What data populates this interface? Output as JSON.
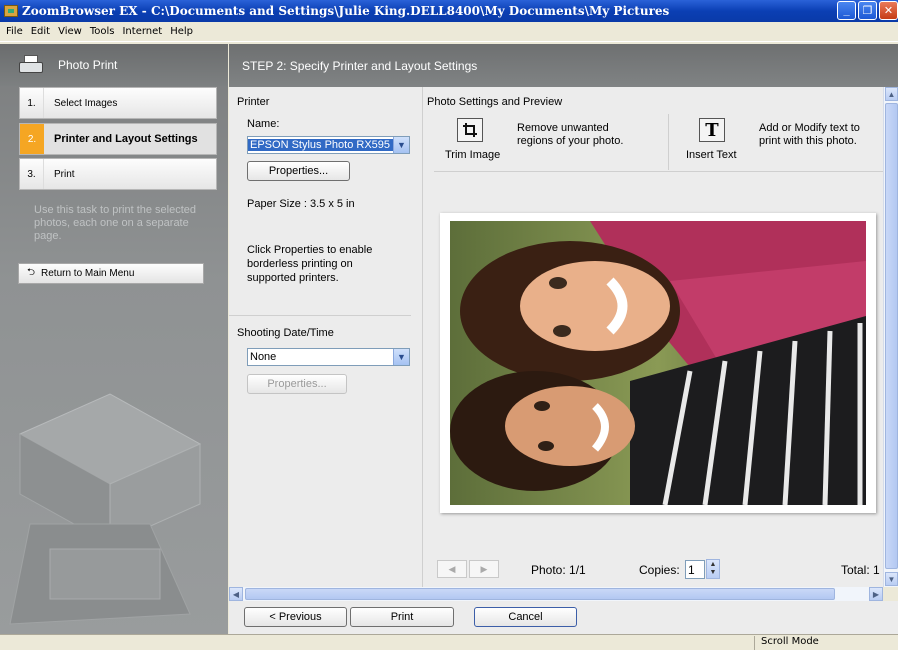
{
  "window": {
    "title": "ZoomBrowser EX  -  C:\\Documents and Settings\\Julie King.DELL8400\\My Documents\\My Pictures",
    "buttons": [
      "minimize-icon",
      "maximize-icon",
      "close-icon"
    ]
  },
  "menu": [
    "File",
    "Edit",
    "View",
    "Tools",
    "Internet",
    "Help"
  ],
  "sidebar": {
    "header": "Photo Print",
    "steps": [
      {
        "num": "1.",
        "label": "Select Images"
      },
      {
        "num": "2.",
        "label": "Printer and Layout Settings"
      },
      {
        "num": "3.",
        "label": "Print"
      }
    ],
    "description": "Use this task to print the selected photos, each one on a separate page.",
    "return_label": "Return to Main Menu"
  },
  "main": {
    "header": "STEP 2: Specify Printer and Layout Settings",
    "printer": {
      "section_label": "Printer",
      "name_label": "Name:",
      "name_value": "EPSON Stylus Photo RX595",
      "properties_label": "Properties...",
      "paper_size": "Paper Size : 3.5 x 5 in",
      "note": "Click Properties to enable borderless printing on supported printers."
    },
    "shooting": {
      "section_label": "Shooting Date/Time",
      "value": "None",
      "properties_label": "Properties..."
    },
    "preview": {
      "section_label": "Photo Settings and Preview",
      "trim_label": "Trim Image",
      "trim_desc": "Remove unwanted regions of your photo.",
      "insert_label": "Insert Text",
      "insert_glyph": "T",
      "insert_desc": "Add or Modify text to print with this photo.",
      "photo_counter": "Photo: 1/1",
      "copies_label": "Copies:",
      "copies_value": "1",
      "total": "Total: 1"
    }
  },
  "footer": {
    "previous_label": "< Previous",
    "print_label": "Print",
    "cancel_label": "Cancel"
  },
  "status": {
    "mode": "Scroll Mode"
  },
  "colors": {
    "titlebar": "#0b3fb4",
    "active_step": "#f5a623",
    "panel_gray": "#808384",
    "selection": "#316ac5"
  }
}
